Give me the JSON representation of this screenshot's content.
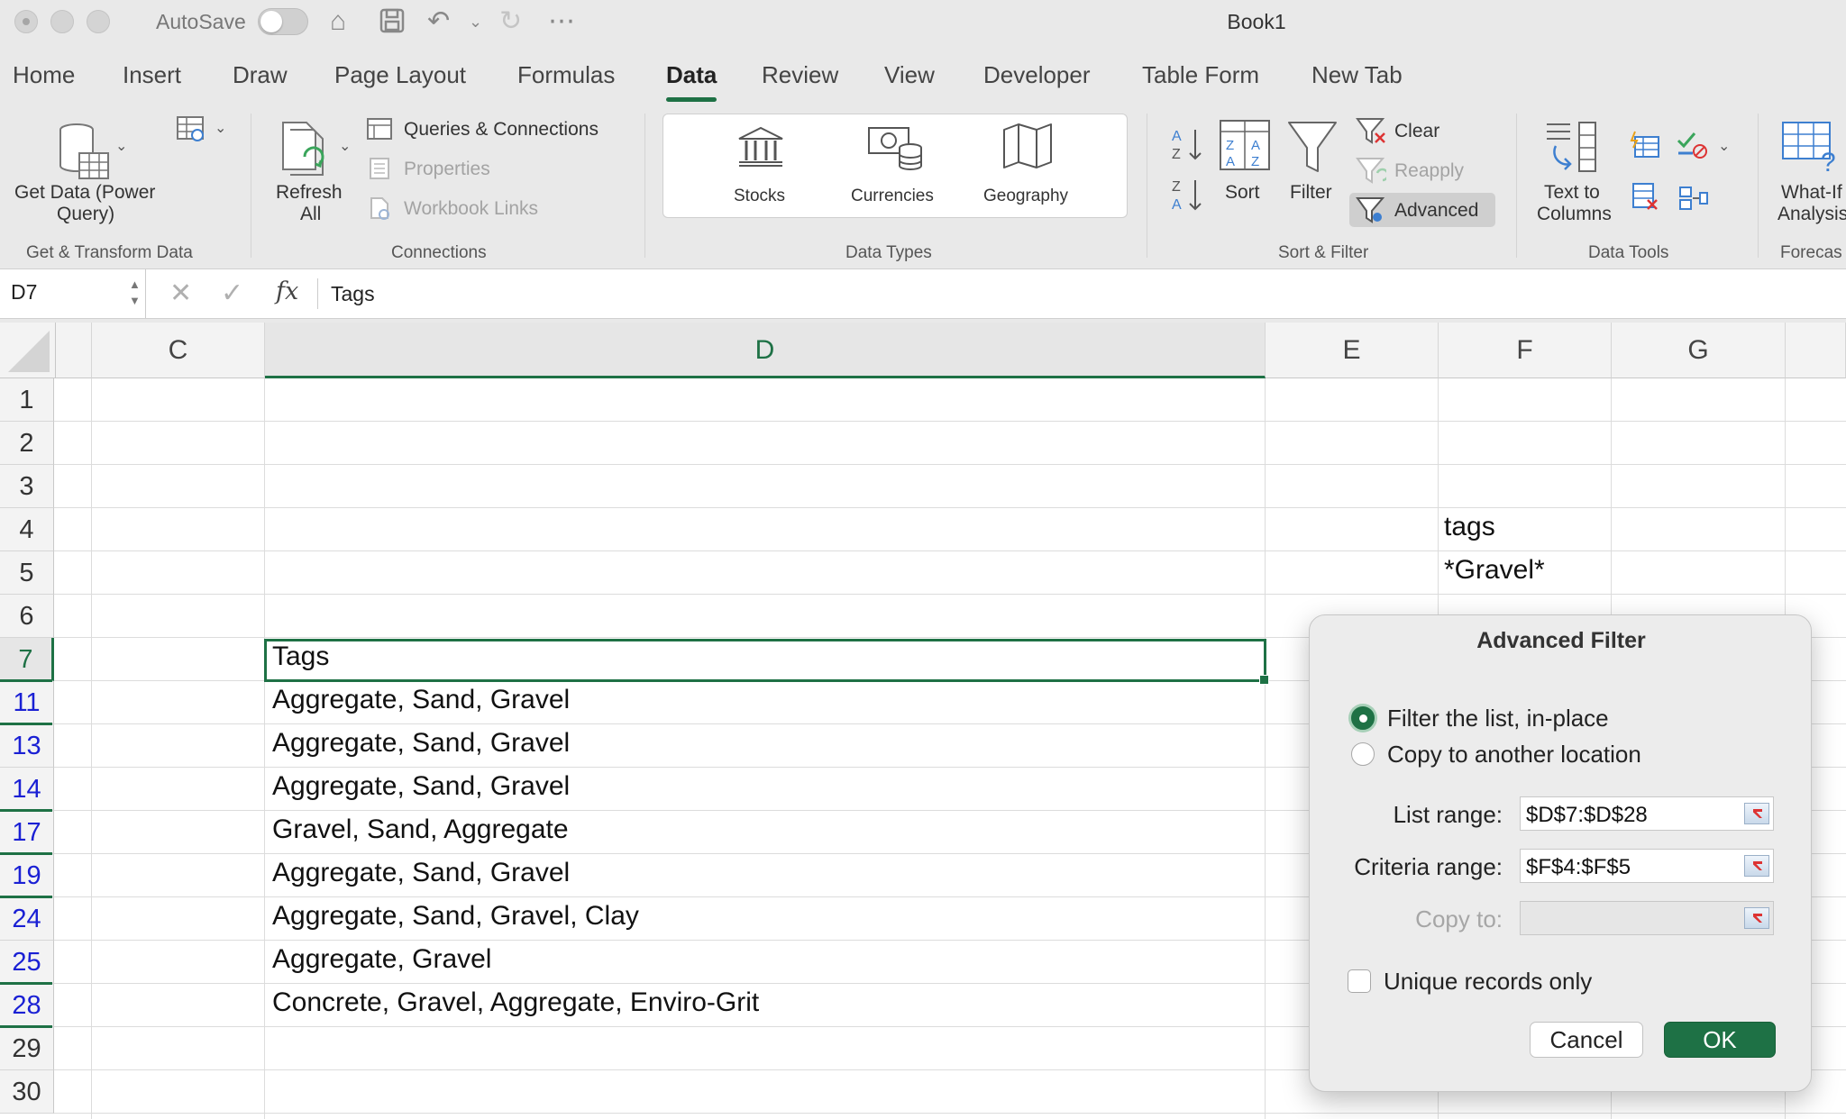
{
  "titlebar": {
    "autosave_label": "AutoSave",
    "document_title": "Book1"
  },
  "tabs": [
    "Home",
    "Insert",
    "Draw",
    "Page Layout",
    "Formulas",
    "Data",
    "Review",
    "View",
    "Developer",
    "Table Form",
    "New Tab"
  ],
  "active_tab": "Data",
  "ribbon": {
    "get_data": "Get Data (Power",
    "get_data_2": "Query)",
    "group_get_transform": "Get & Transform Data",
    "refresh_all": "Refresh",
    "refresh_all_2": "All",
    "queries_connections": "Queries & Connections",
    "properties": "Properties",
    "workbook_links": "Workbook Links",
    "group_connections": "Connections",
    "stocks": "Stocks",
    "currencies": "Currencies",
    "geography": "Geography",
    "group_data_types": "Data Types",
    "sort": "Sort",
    "filter": "Filter",
    "clear": "Clear",
    "reapply": "Reapply",
    "advanced": "Advanced",
    "group_sort_filter": "Sort & Filter",
    "text_to_columns": "Text to",
    "text_to_columns_2": "Columns",
    "group_data_tools": "Data Tools",
    "what_if": "What-If",
    "what_if_2": "Analysis",
    "group_forecast": "Forecas"
  },
  "formula_bar": {
    "name_box": "D7",
    "fx": "fx",
    "content": "Tags"
  },
  "columns": [
    "C",
    "D",
    "E",
    "F",
    "G"
  ],
  "rows": [
    "1",
    "2",
    "3",
    "4",
    "5",
    "6",
    "7",
    "11",
    "13",
    "14",
    "17",
    "19",
    "24",
    "25",
    "28",
    "29",
    "30"
  ],
  "cells": {
    "F4": "tags",
    "F5": "*Gravel*",
    "D7": "Tags",
    "D11": "Aggregate, Sand, Gravel",
    "D13": "Aggregate, Sand, Gravel",
    "D14": "Aggregate, Sand, Gravel",
    "D17": "Gravel, Sand, Aggregate",
    "D19": "Aggregate, Sand, Gravel",
    "D24": "Aggregate, Sand, Gravel, Clay",
    "D25": "Aggregate, Gravel",
    "D28": "Concrete, Gravel, Aggregate, Enviro-Grit"
  },
  "dialog": {
    "title": "Advanced Filter",
    "option_in_place": "Filter the list, in-place",
    "option_copy": "Copy to another location",
    "list_range_label": "List range:",
    "list_range_value": "$D$7:$D$28",
    "criteria_range_label": "Criteria range:",
    "criteria_range_value": "$F$4:$F$5",
    "copy_to_label": "Copy to:",
    "copy_to_value": "",
    "unique_label": "Unique records only",
    "cancel": "Cancel",
    "ok": "OK"
  },
  "colors": {
    "accent": "#1e7145",
    "filtered_row_number": "#1a20d4"
  }
}
